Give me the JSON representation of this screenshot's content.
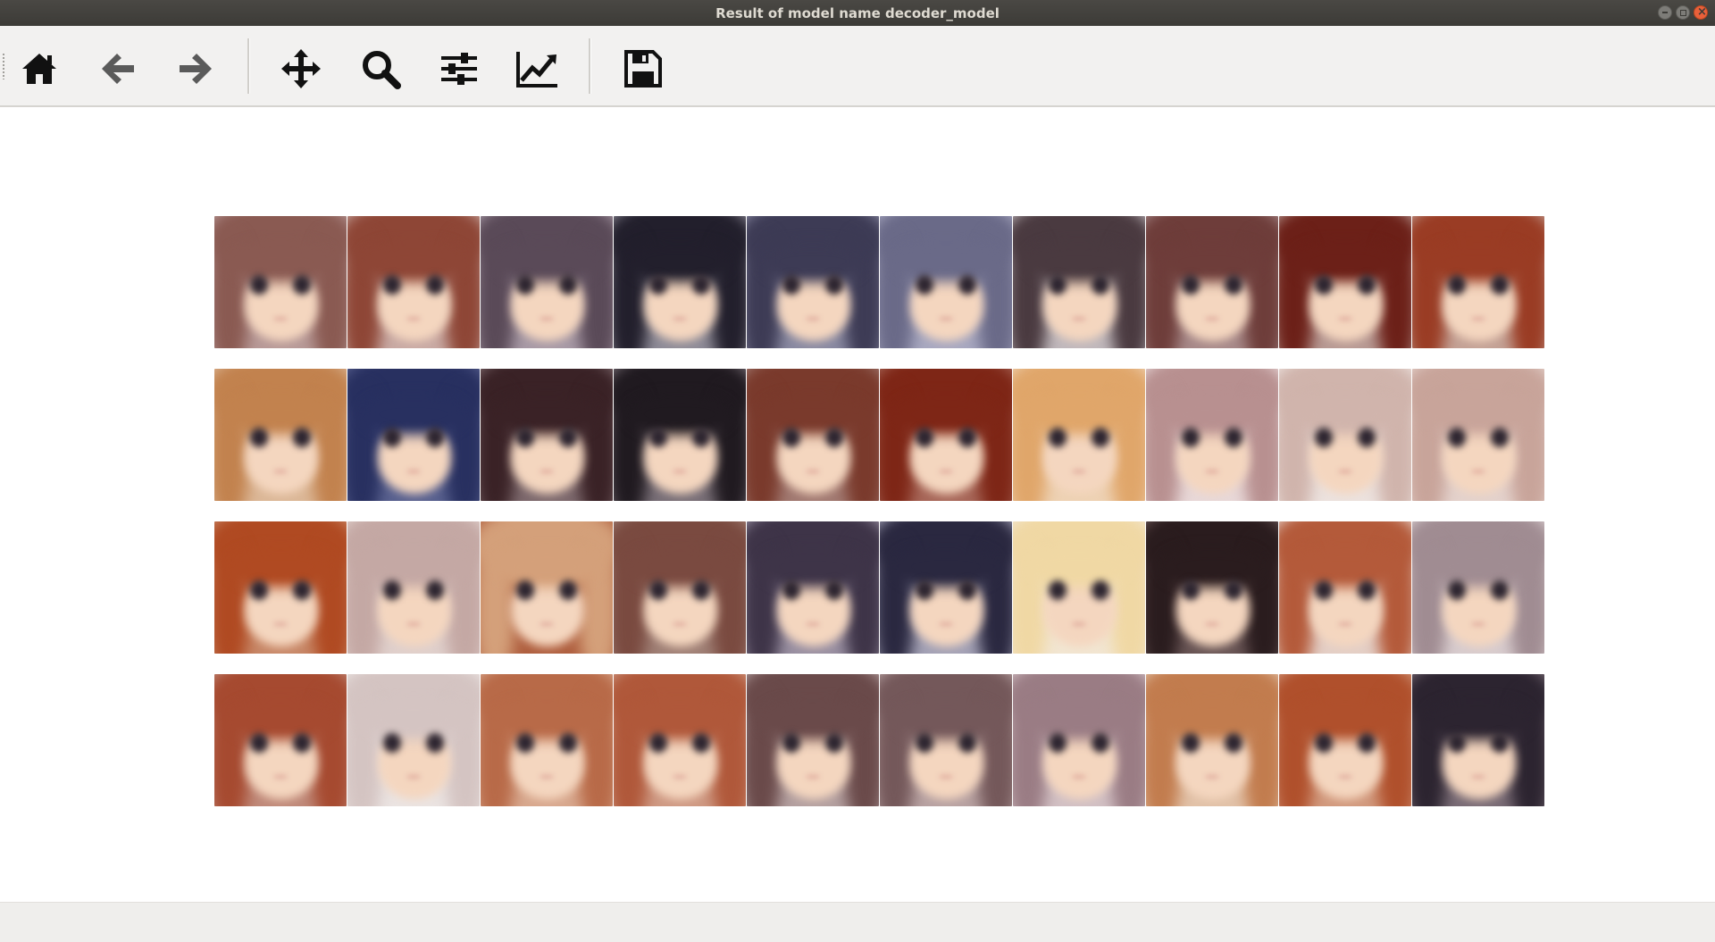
{
  "window": {
    "title": "Result of model name decoder_model",
    "controls": [
      "minimize",
      "maximize",
      "close"
    ]
  },
  "toolbar": {
    "tools": [
      {
        "name": "home",
        "icon": "home-icon"
      },
      {
        "name": "back",
        "icon": "arrow-left-icon"
      },
      {
        "name": "forward",
        "icon": "arrow-right-icon"
      },
      {
        "name": "pan",
        "icon": "move-icon"
      },
      {
        "name": "zoom",
        "icon": "magnifier-icon"
      },
      {
        "name": "configure-subplots",
        "icon": "sliders-icon"
      },
      {
        "name": "edit-axes",
        "icon": "line-chart-icon"
      },
      {
        "name": "save",
        "icon": "floppy-disk-icon"
      }
    ],
    "icon_color": "#111111",
    "disabled_icon_color": "#5a5a5a"
  },
  "figure": {
    "rows": 4,
    "cols": 10,
    "faces": [
      {
        "hair": "#8a5a52",
        "bg": "#b89a98"
      },
      {
        "hair": "#8e4636",
        "bg": "#c9aaa4"
      },
      {
        "hair": "#5a4a58",
        "bg": "#a89aa6"
      },
      {
        "hair": "#221f2c",
        "bg": "#8f8c98"
      },
      {
        "hair": "#3d3b55",
        "bg": "#8a8aa2"
      },
      {
        "hair": "#6a6a88",
        "bg": "#a8a8c0"
      },
      {
        "hair": "#4a3a40",
        "bg": "#c0b8bc"
      },
      {
        "hair": "#6e3d3a",
        "bg": "#a88a8a"
      },
      {
        "hair": "#6c2018",
        "bg": "#b89a94"
      },
      {
        "hair": "#9a3c24",
        "bg": "#c4a296"
      },
      {
        "hair": "#c2824e",
        "bg": "#dcb898"
      },
      {
        "hair": "#283060",
        "bg": "#5a6290"
      },
      {
        "hair": "#3a2226",
        "bg": "#7e6a6e"
      },
      {
        "hair": "#201a20",
        "bg": "#7a7078"
      },
      {
        "hair": "#7a3a2c",
        "bg": "#a27a72"
      },
      {
        "hair": "#7e2616",
        "bg": "#a8685a"
      },
      {
        "hair": "#e0a66a",
        "bg": "#eed2b4"
      },
      {
        "hair": "#b89090",
        "bg": "#e8d8d8"
      },
      {
        "hair": "#d0b4ac",
        "bg": "#ece2de"
      },
      {
        "hair": "#c8a49a",
        "bg": "#e4d2cc"
      },
      {
        "hair": "#b04a22",
        "bg": "#c88868"
      },
      {
        "hair": "#c4a8a4",
        "bg": "#e0d0cc"
      },
      {
        "hair": "#d4a07a",
        "bg": "#b06040"
      },
      {
        "hair": "#7a4a40",
        "bg": "#a08076"
      },
      {
        "hair": "#3e3448",
        "bg": "#9a90a2"
      },
      {
        "hair": "#2a2840",
        "bg": "#a4a2b6"
      },
      {
        "hair": "#f0d8a4",
        "bg": "#f2e6d2"
      },
      {
        "hair": "#2a1c1e",
        "bg": "#6a5656"
      },
      {
        "hair": "#b45a3a",
        "bg": "#e4cfc6"
      },
      {
        "hair": "#a08c92",
        "bg": "#d8ccce"
      },
      {
        "hair": "#a64a30",
        "bg": "#c08a7a"
      },
      {
        "hair": "#d4c4c2",
        "bg": "#ebe4e2"
      },
      {
        "hair": "#b86a48",
        "bg": "#d8a88e"
      },
      {
        "hair": "#b0583a",
        "bg": "#cf9a84"
      },
      {
        "hair": "#6a4a4a",
        "bg": "#b4a0a0"
      },
      {
        "hair": "#74585a",
        "bg": "#b8a2a2"
      },
      {
        "hair": "#9a7c84",
        "bg": "#d2c0c4"
      },
      {
        "hair": "#c27c4e",
        "bg": "#e2c2a8"
      },
      {
        "hair": "#b0502c",
        "bg": "#d29a7e"
      },
      {
        "hair": "#2c2430",
        "bg": "#7a6c76"
      }
    ]
  }
}
